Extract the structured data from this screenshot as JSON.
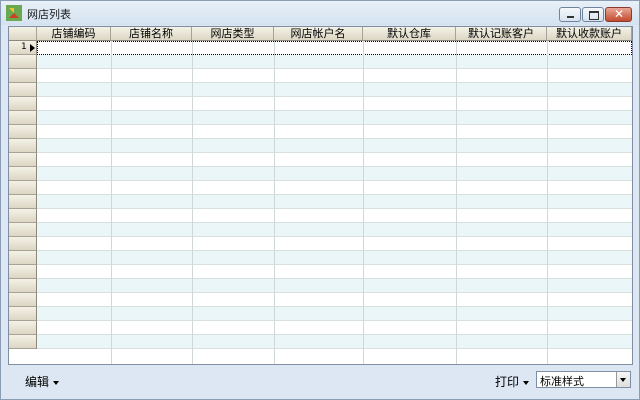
{
  "window": {
    "title": "网店列表",
    "close_glyph": "✕",
    "icon": "app-icon"
  },
  "grid": {
    "columns": [
      "店铺编码",
      "店铺名称",
      "网店类型",
      "网店帐户名",
      "默认仓库",
      "默认记账客户",
      "默认收款账户"
    ],
    "first_row_number": "1",
    "visible_row_count": 22
  },
  "toolbar": {
    "edit_label": "编辑",
    "print_label": "打印",
    "style_select_value": "标准样式"
  }
}
